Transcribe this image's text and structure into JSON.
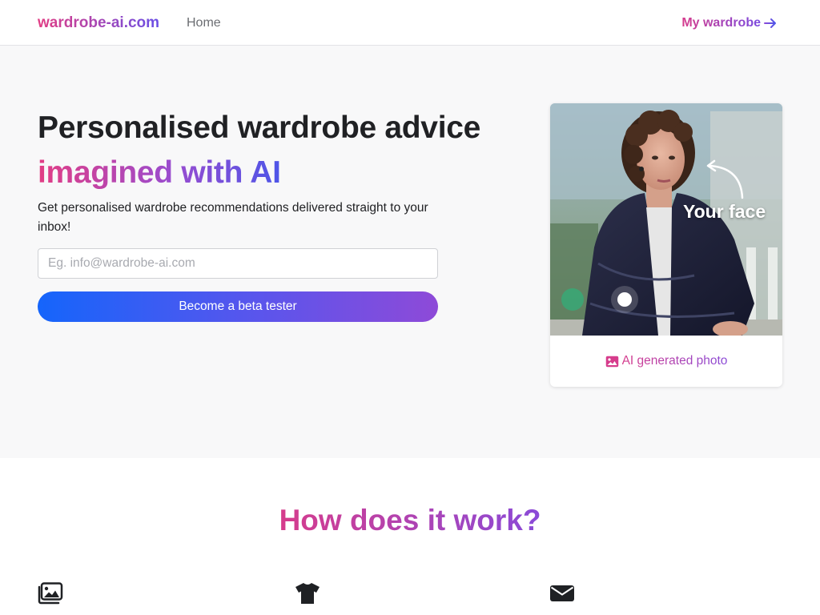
{
  "nav": {
    "brand": "wardrobe-ai.com",
    "home": "Home",
    "my_wardrobe": "My wardrobe",
    "arrow_icon": "arrow-right-icon"
  },
  "hero": {
    "title_line1": "Personalised wardrobe advice",
    "title_line2": "imagined with AI",
    "subtitle": "Get personalised wardrobe recommendations delivered straight to your inbox!",
    "email_placeholder": "Eg. info@wardrobe-ai.com",
    "email_value": "",
    "cta_label": "Become a beta tester"
  },
  "photo_card": {
    "overlay_label": "Your face",
    "caption": "AI generated photo",
    "caption_icon": "image-icon"
  },
  "how": {
    "title": "How does it work?",
    "steps": [
      {
        "icon": "images-icon"
      },
      {
        "icon": "tshirt-icon"
      },
      {
        "icon": "envelope-icon"
      }
    ]
  },
  "colors": {
    "accent_pink": "#e23d84",
    "accent_purple": "#8a4ad8",
    "accent_blue": "#1565fb",
    "hero_bg": "#f8f8f9"
  }
}
